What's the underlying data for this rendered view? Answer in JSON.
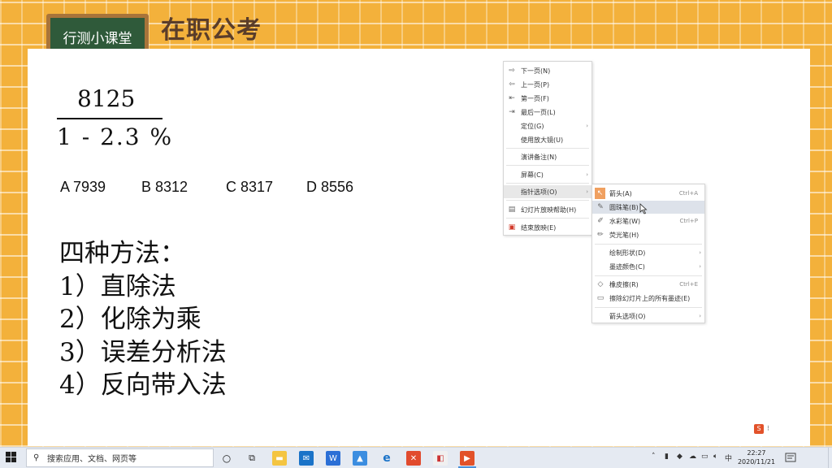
{
  "slide": {
    "board_label": "行测小课堂",
    "brand": "在职公考",
    "fraction": {
      "numerator": "8125",
      "denominator": "1 - 2.3 %"
    },
    "options": {
      "a": "A 7939",
      "b": "B 8312",
      "c": "C 8317",
      "d": "D 8556"
    },
    "methods_title": "四种方法：",
    "methods": [
      "1）直除法",
      "2）化除为乘",
      "3）误差分析法",
      "4）反向带入法"
    ]
  },
  "context_menu": {
    "items": [
      {
        "icon": "arrow-right-icon",
        "label": "下一页(N)"
      },
      {
        "icon": "arrow-left-icon",
        "label": "上一页(P)"
      },
      {
        "icon": "first-page-icon",
        "label": "第一页(F)"
      },
      {
        "icon": "last-page-icon",
        "label": "最后一页(L)"
      },
      {
        "label": "定位(G)",
        "submenu": true
      },
      {
        "label": "使用放大镜(U)"
      },
      {
        "label": "演讲备注(N)"
      },
      {
        "label": "屏幕(C)",
        "submenu": true
      },
      {
        "label": "指针选项(O)",
        "submenu": true,
        "highlighted": true
      },
      {
        "icon": "slide-help-icon",
        "label": "幻灯片放映帮助(H)"
      },
      {
        "icon": "end-show-icon",
        "label": "结束放映(E)"
      }
    ]
  },
  "pointer_submenu": {
    "items": [
      {
        "icon": "arrow-cursor-icon",
        "label": "箭头(A)",
        "shortcut": "Ctrl+A",
        "checked": true
      },
      {
        "icon": "ballpoint-pen-icon",
        "label": "圆珠笔(B)",
        "highlighted": true
      },
      {
        "icon": "watercolor-pen-icon",
        "label": "水彩笔(W)",
        "shortcut": "Ctrl+P"
      },
      {
        "icon": "highlighter-icon",
        "label": "荧光笔(H)"
      },
      {
        "label": "绘制形状(D)",
        "submenu": true
      },
      {
        "label": "墨迹颜色(C)",
        "submenu": true
      },
      {
        "icon": "eraser-icon",
        "label": "橡皮擦(R)",
        "shortcut": "Ctrl+E"
      },
      {
        "icon": "erase-all-icon",
        "label": "擦除幻灯片上的所有墨迹(E)"
      },
      {
        "label": "箭头选项(O)",
        "submenu": true
      }
    ]
  },
  "taskbar": {
    "search_placeholder": "搜索应用、文档、网页等",
    "time": "22:27",
    "date": "2020/11/21"
  }
}
